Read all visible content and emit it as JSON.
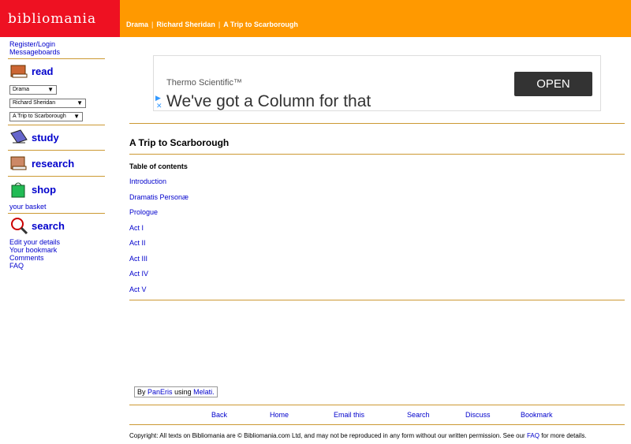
{
  "logo": "bibliomania",
  "breadcrumb": [
    "Drama",
    "Richard Sheridan",
    "A Trip to Scarborough"
  ],
  "sidebar": {
    "register": "Register/Login",
    "messageboards": "Messageboards",
    "read": "read",
    "selects": [
      "Drama",
      "Richard Sheridan",
      "A Trip to Scarborough"
    ],
    "study": "study",
    "research": "research",
    "shop": "shop",
    "basket": "your basket",
    "search": "search",
    "links": [
      "Edit your details",
      "Your bookmark",
      "Comments",
      "FAQ"
    ]
  },
  "ad": {
    "brand": "Thermo Scientific™",
    "headline": "We've got a Column for that",
    "button": "OPEN"
  },
  "main": {
    "title": "A Trip to Scarborough",
    "toc_heading": "Table of contents",
    "toc": [
      "Introduction",
      "Dramatis Personæ",
      "Prologue",
      "Act I",
      "Act II",
      "Act III",
      "Act IV",
      "Act V"
    ]
  },
  "credit": {
    "by": "By",
    "paneris": "PanEris",
    "using": "using",
    "melati": "Melati."
  },
  "footer_nav": [
    "Back",
    "Home",
    "Email this",
    "Search",
    "Discuss",
    "Bookmark"
  ],
  "copyright": {
    "pre": "Copyright: All texts on Bibliomania are © Bibliomania.com Ltd, and may not be reproduced in any form without our written permission. See our",
    "faq": "FAQ",
    "post": "for more details."
  }
}
